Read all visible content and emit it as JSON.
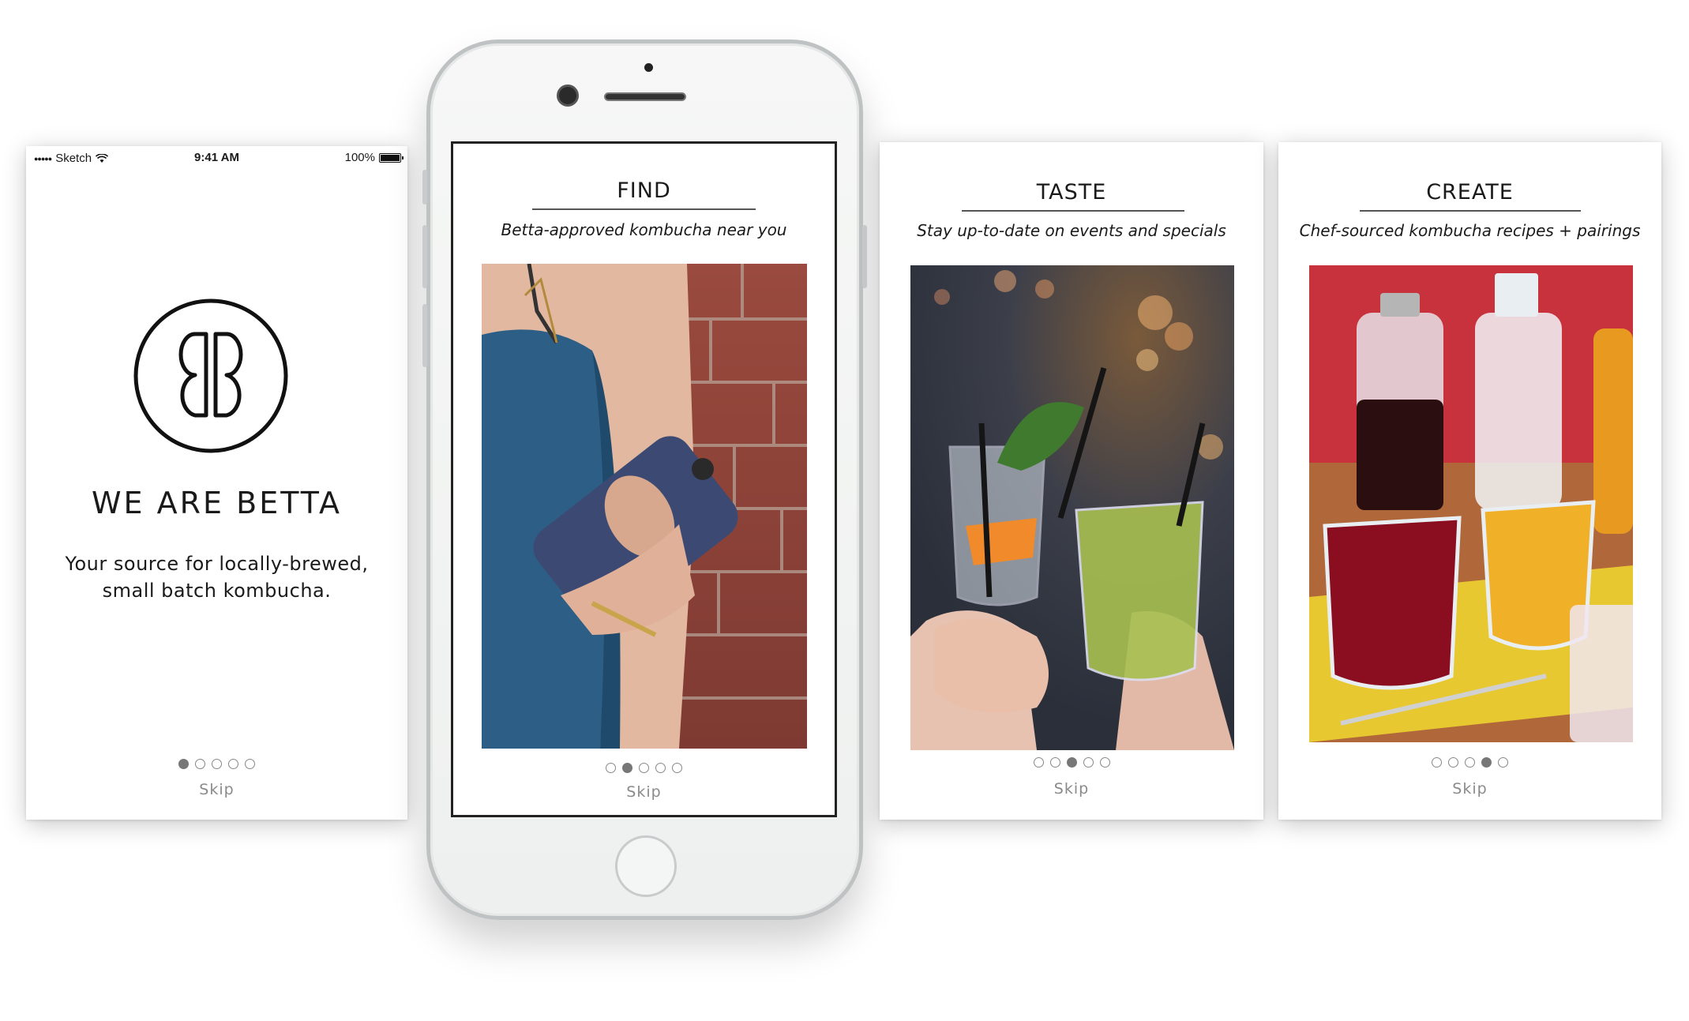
{
  "screen1": {
    "status": {
      "carrier": "Sketch",
      "time": "9:41 AM",
      "battery": "100%"
    },
    "title": "WE ARE BETTA",
    "subtitle_line1": "Your source for locally-brewed,",
    "subtitle_line2": "small batch kombucha.",
    "pagination": {
      "total": 5,
      "active": 1
    },
    "skip": "Skip"
  },
  "screen2": {
    "title": "FIND",
    "subtitle": "Betta-approved kombucha near you",
    "pagination": {
      "total": 5,
      "active": 2
    },
    "skip": "Skip"
  },
  "screen3": {
    "title": "TASTE",
    "subtitle": "Stay up-to-date on events and specials",
    "pagination": {
      "total": 5,
      "active": 3
    },
    "skip": "Skip"
  },
  "screen4": {
    "title": "CREATE",
    "subtitle": "Chef-sourced kombucha recipes + pairings",
    "pagination": {
      "total": 5,
      "active": 4
    },
    "skip": "Skip"
  },
  "colors": {
    "dot_active": "#777777",
    "skip_text": "#8a8a8a",
    "phone_frame": "#bfc2c3"
  }
}
